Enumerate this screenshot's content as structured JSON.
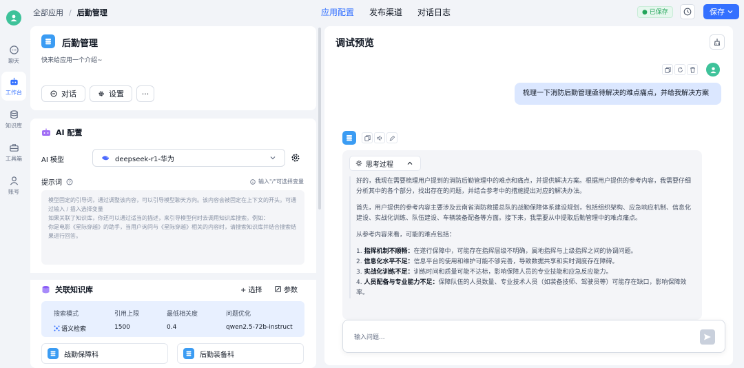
{
  "rail": {
    "items": [
      {
        "label": "聊天",
        "icon": "chat-icon"
      },
      {
        "label": "工作台",
        "icon": "robot-icon"
      },
      {
        "label": "知识库",
        "icon": "database-icon"
      },
      {
        "label": "工具箱",
        "icon": "toolbox-icon"
      },
      {
        "label": "账号",
        "icon": "user-icon"
      }
    ]
  },
  "header": {
    "breadcrumb_root": "全部应用",
    "breadcrumb_current": "后勤管理",
    "tabs": [
      "应用配置",
      "发布渠道",
      "对话日志"
    ],
    "active_tab": "应用配置",
    "saved_status": "● 已保存",
    "save_label": "保存"
  },
  "app": {
    "name": "后勤管理",
    "intro": "快来给应用一个介绍~",
    "chat_button": "对话",
    "settings_button": "设置",
    "more_button": "···"
  },
  "config": {
    "title": "AI 配置",
    "model_label": "AI 模型",
    "model_value": "deepseek-r1-华为",
    "prompt_label": "提示词",
    "prompt_hint": "输入\"/\"可选择变量",
    "prompt_placeholder": [
      "模型固定的引导词，通过调整该内容，可以引导模型聊天方向。该内容会被固定在上下文的开头。可通过输入 / 插入选择变量",
      "如果关联了知识库，你还可以通过适当的描述，来引导模型何时去调用知识库搜索。例如：",
      "你是电影《星际穿越》的助手，当用户询问与《星际穿越》相关的内容时，请搜索知识库并结合搜索结果进行回答。"
    ],
    "kb_title": "关联知识库",
    "kb_select": "+ 选择",
    "kb_params": "参数",
    "kb_headers": [
      "搜索模式",
      "引用上限",
      "最低相关度",
      "问题优化"
    ],
    "kb_values": [
      "语义检索",
      "1500",
      "0.4",
      "qwen2.5-72b-instruct"
    ],
    "datasets": [
      "战勤保障科",
      "后勤装备科"
    ]
  },
  "preview": {
    "title": "调试预览",
    "user_message": "梳理一下消防后勤管理亟待解决的难点痛点，并给我解决方案",
    "think_label": "思考过程",
    "paragraphs": [
      "好的，我现在需要梳理用户提到的消防后勤管理中的难点和痛点，并提供解决方案。根据用户提供的参考内容，我需要仔细分析其中的各个部分，找出存在的问题，并结合参考中的措施提出对应的解决办法。",
      "首先，用户提供的参考内容主要涉及云南省消防救援总队的战勤保障体系建设规划，包括组织架构、应急响应机制、信息化建设、实战化训练、队伍建设、车辆装备配备等方面。接下来，我需要从中提取后勤管理中的难点痛点。",
      "从参考内容来看，可能的难点包括："
    ],
    "points": [
      {
        "num": "1.",
        "title": "指挥机制不顺畅：",
        "text": "在遂行保障中，可能存在指挥层级不明确，属地指挥与上级指挥之间的协调问题。"
      },
      {
        "num": "2.",
        "title": "信息化水平不足：",
        "text": "信息平台的使用和维护可能不够完善，导致数据共享和实时调度存在障碍。"
      },
      {
        "num": "3.",
        "title": "实战化训练不足：",
        "text": "训练时间和质量可能不达标，影响保障人员的专业技能和应急反应能力。"
      },
      {
        "num": "4.",
        "title": "人员配备与专业能力不足：",
        "text": "保障队伍的人员数量、专业技术人员（如装备技师、驾驶员等）可能存在缺口，影响保障效率。"
      }
    ],
    "input_placeholder": "输入问题..."
  },
  "colors": {
    "accent": "#3370ff",
    "brand_green": "#3ec29a",
    "app_blue": "#3b9cf3"
  }
}
